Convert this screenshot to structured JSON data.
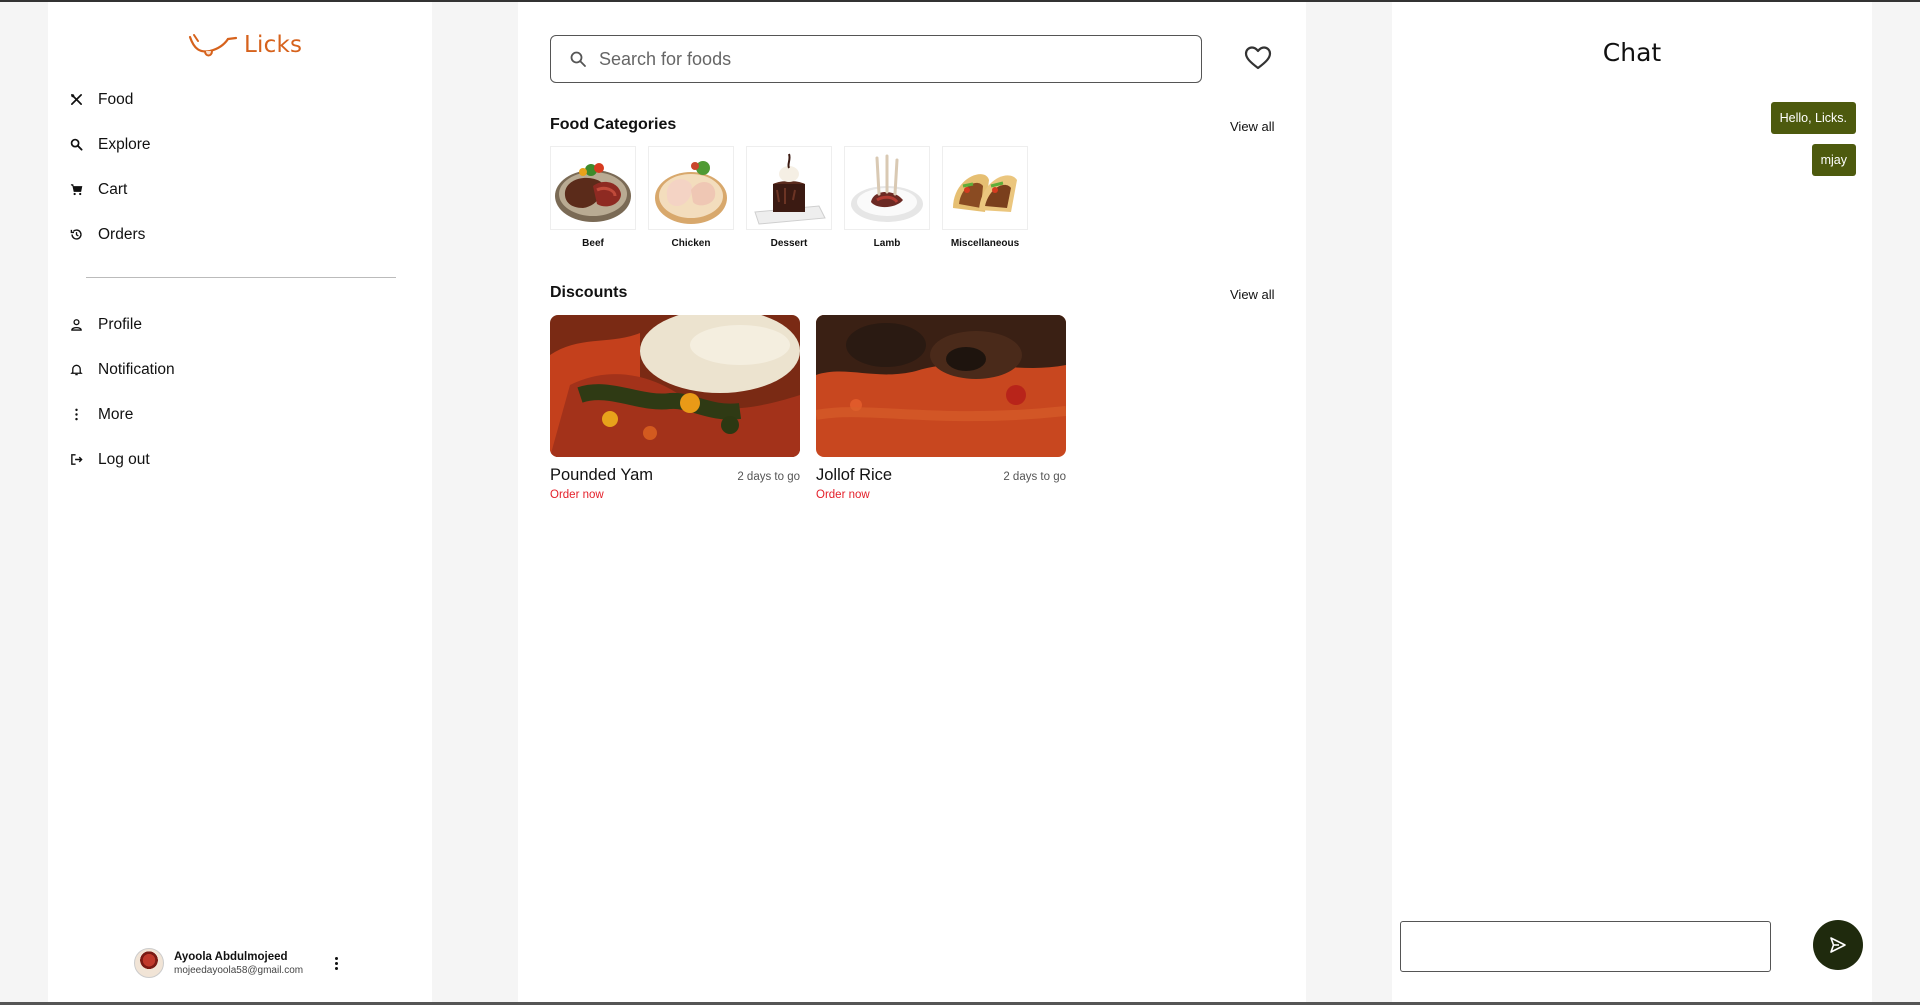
{
  "app": {
    "logo_text": "Licks",
    "brand_color": "#d6621c"
  },
  "sidebar": {
    "primary_items": [
      {
        "label": "Food",
        "icon": "utensils-icon"
      },
      {
        "label": "Explore",
        "icon": "search-icon"
      },
      {
        "label": "Cart",
        "icon": "cart-icon"
      },
      {
        "label": "Orders",
        "icon": "history-icon"
      }
    ],
    "secondary_items": [
      {
        "label": "Profile",
        "icon": "user-icon"
      },
      {
        "label": "Notification",
        "icon": "bell-icon"
      },
      {
        "label": "More",
        "icon": "more-vertical-icon"
      },
      {
        "label": "Log out",
        "icon": "logout-icon"
      }
    ],
    "user": {
      "name": "Ayoola Abdulmojeed",
      "email": "mojeedayoola58@gmail.com"
    }
  },
  "main": {
    "search": {
      "placeholder": "Search for foods",
      "value": ""
    },
    "categories": {
      "title": "Food Categories",
      "view_all": "View all",
      "items": [
        {
          "label": "Beef"
        },
        {
          "label": "Chicken"
        },
        {
          "label": "Dessert"
        },
        {
          "label": "Lamb"
        },
        {
          "label": "Miscellaneous"
        }
      ]
    },
    "discounts": {
      "title": "Discounts",
      "view_all": "View all",
      "items": [
        {
          "name": "Pounded Yam",
          "time": "2 days to go",
          "action": "Order now"
        },
        {
          "name": "Jollof Rice",
          "time": "2 days to go",
          "action": "Order now"
        }
      ]
    }
  },
  "chat": {
    "title": "Chat",
    "messages": [
      "Hello, Licks.",
      "mjay"
    ],
    "input_value": "",
    "accent_color": "#4d5a0e"
  }
}
